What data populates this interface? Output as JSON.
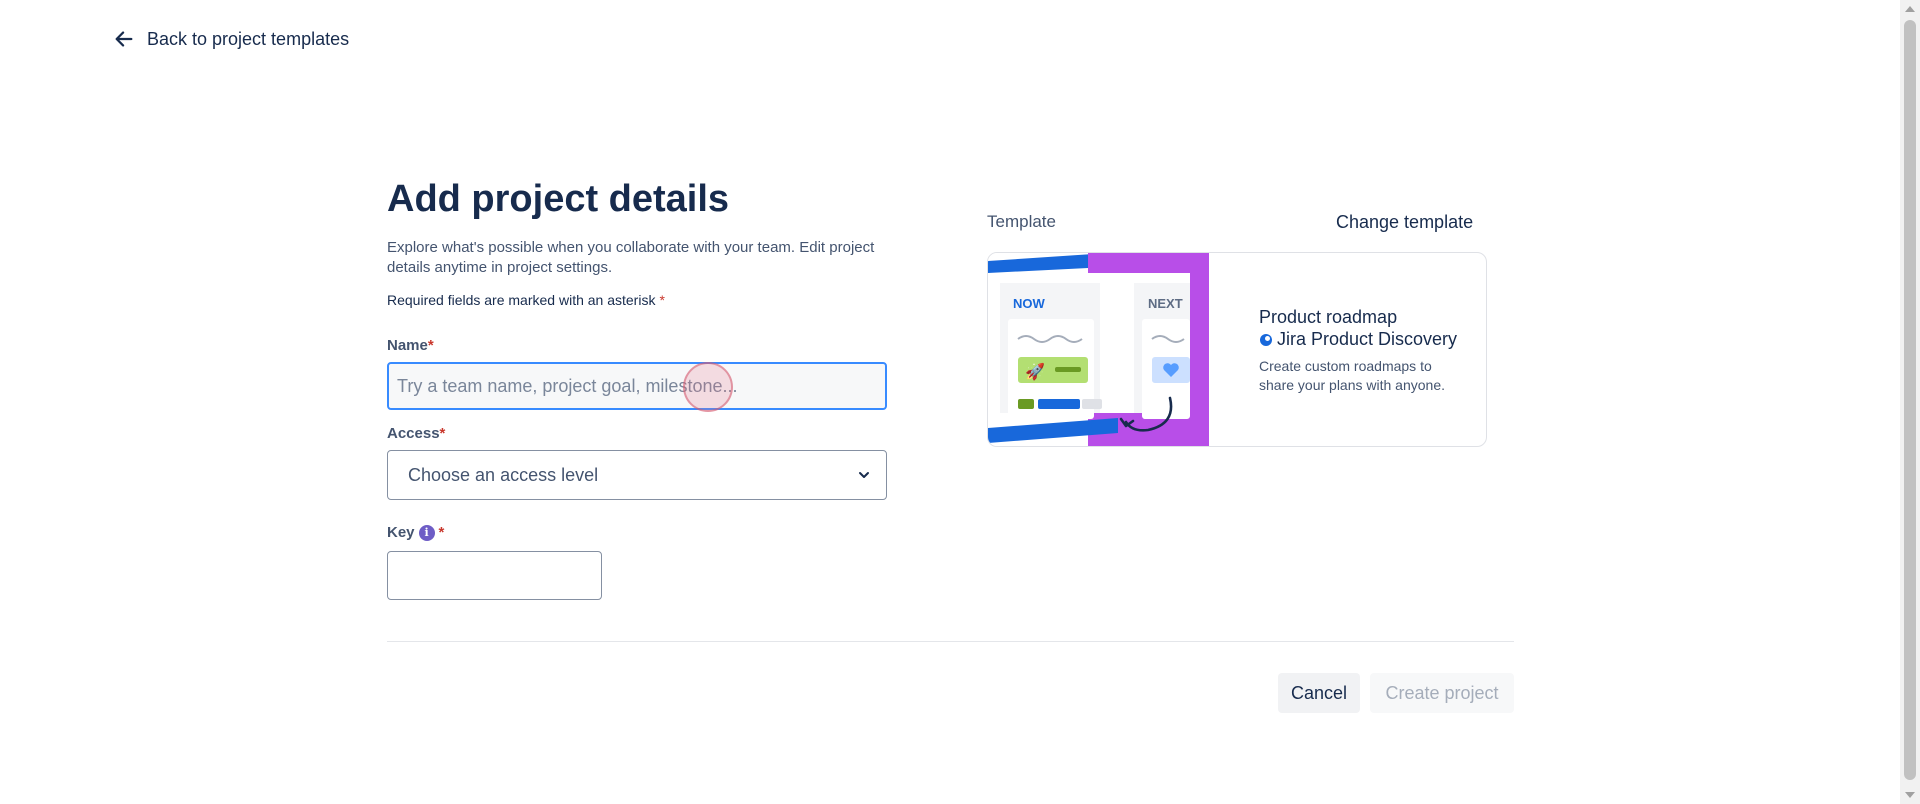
{
  "nav": {
    "back_label": "Back to project templates"
  },
  "main": {
    "title": "Add project details",
    "description": "Explore what's possible when you collaborate with your team. Edit project details anytime in project settings.",
    "required_note": "Required fields are marked with an asterisk",
    "required_marker": "*"
  },
  "form": {
    "name": {
      "label": "Name",
      "placeholder": "Try a team name, project goal, milestone...",
      "value": ""
    },
    "access": {
      "label": "Access",
      "placeholder": "Choose an access level"
    },
    "key": {
      "label": "Key",
      "info_icon": "i",
      "value": ""
    }
  },
  "template": {
    "section_label": "Template",
    "change_label": "Change template",
    "name": "Product roadmap",
    "brand": "Jira Product Discovery",
    "description": "Create custom roadmaps to share your plans with anyone.",
    "art": {
      "col1_label": "NOW",
      "col2_label": "NEXT"
    }
  },
  "actions": {
    "cancel_label": "Cancel",
    "create_label": "Create project",
    "create_disabled": true
  },
  "colors": {
    "accent": "#388bff",
    "primary_text": "#172b4d",
    "required": "#c9372c",
    "purple": "#b84ee8",
    "blue": "#1868db"
  }
}
